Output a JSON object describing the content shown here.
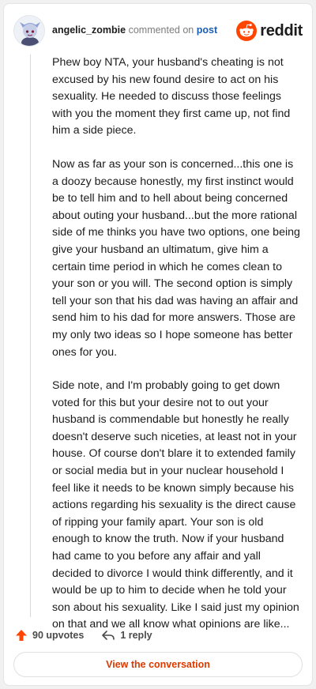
{
  "comment": {
    "username": "angelic_zombie",
    "commented_text": "commented on",
    "post_link_label": "post",
    "brand_name": "reddit",
    "paragraphs": [
      "Phew boy NTA, your husband's cheating is not excused by his new found desire to act on his sexuality. He needed to discuss those feelings with you the moment they first came up, not find him a side piece.",
      "Now as far as your son is concerned...this one is a doozy because honestly, my first instinct would be to tell him and to hell about being concerned about outing your husband...but the more rational side of me thinks you have two options, one being give your husband an ultimatum, give him a certain time period in which he comes clean to your son or you will. The second option is simply tell your son that his dad was having an affair and send him to his dad for more answers. Those are my only two ideas so I hope someone has better ones for you.",
      "Side note, and I'm probably going to get down voted for this but your desire not to out your husband is commendable but honestly he really doesn't deserve such niceties, at least not in your house. Of course don't blare it to extended family or social media but in your nuclear household I feel like it needs to be known simply because his actions regarding his sexuality is the direct cause of ripping your family apart. Your son is old enough to know the truth. Now if your husband had came to you before any affair and yall decided to divorce I would think differently, and it would be up to him to decide when he told your son about his sexuality. Like I said just my opinion on that and we all know what opinions are like..."
    ]
  },
  "actions": {
    "upvotes_label": "90 upvotes",
    "replies_label": "1 reply",
    "view_conversation_label": "View the conversation"
  },
  "icons": {
    "upvote": "upvote-arrow-icon",
    "reply": "reply-arrow-icon",
    "brand": "reddit-snoo-icon"
  },
  "colors": {
    "accent": "#d93a00",
    "upvote": "#ff4500",
    "link": "#1a5fb4"
  }
}
